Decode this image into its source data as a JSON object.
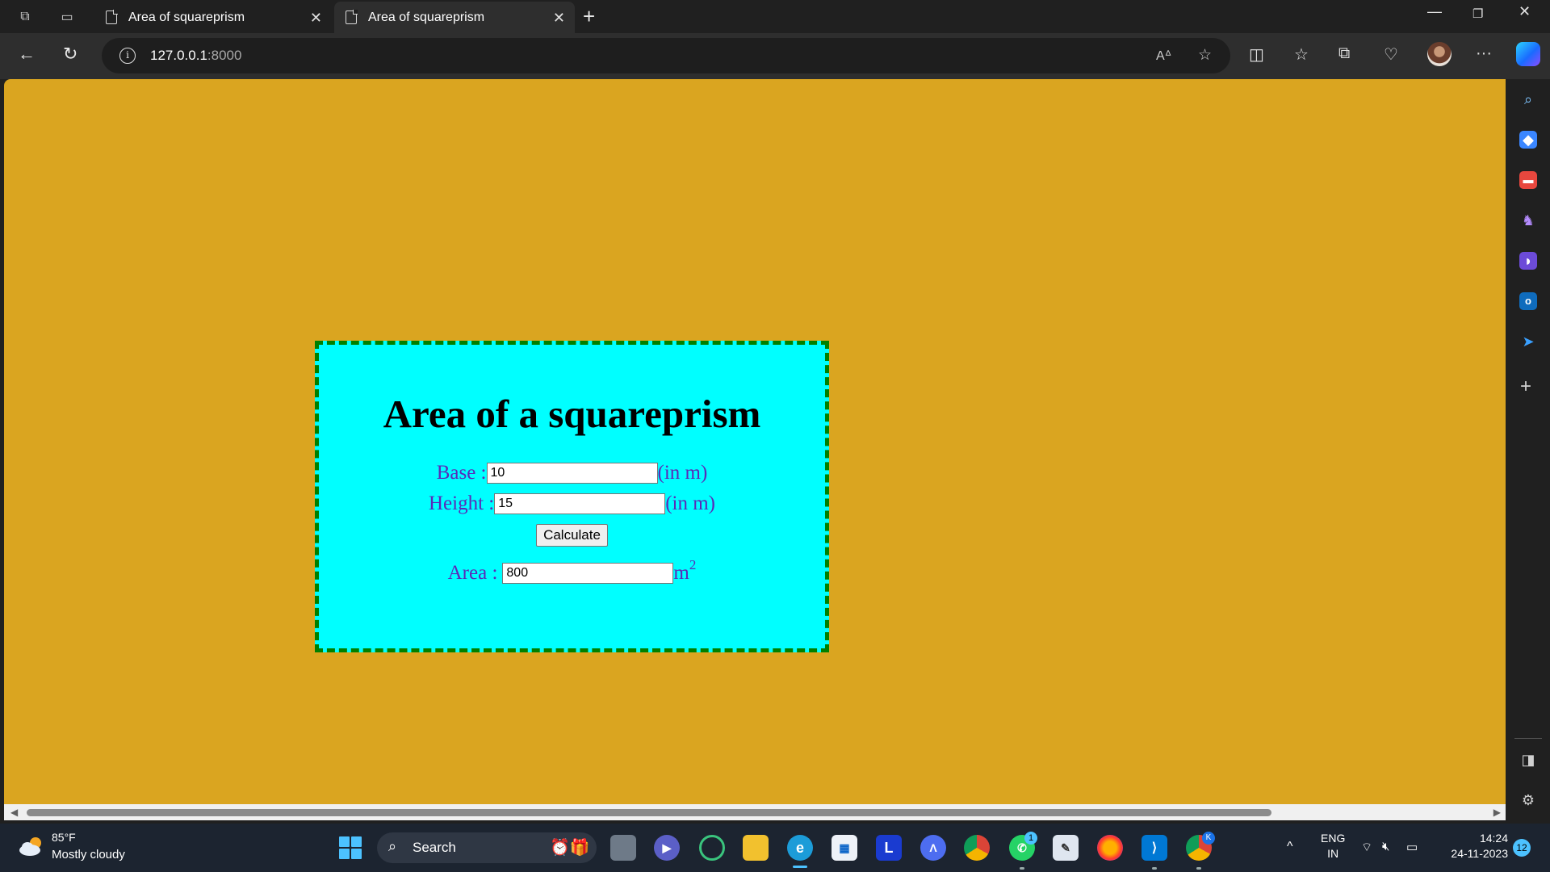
{
  "browser": {
    "tabs": [
      {
        "title": "Area of squareprism"
      },
      {
        "title": "Area of squareprism"
      }
    ],
    "address": {
      "host": "127.0.0.1",
      "port": ":8000"
    }
  },
  "page": {
    "heading": "Area of a squareprism",
    "base": {
      "label": "Base : ",
      "value": "10",
      "unit": "(in m)"
    },
    "height": {
      "label": "Height : ",
      "value": "15",
      "unit": "(in m)"
    },
    "calculate_label": "Calculate",
    "area": {
      "label": "Area : ",
      "value": "800",
      "unit": "m",
      "unit_power": "2"
    },
    "colors": {
      "background": "#daa520",
      "card": "#00ffff",
      "border": "#008000",
      "label_text": "#5a2ab8"
    }
  },
  "taskbar": {
    "weather": {
      "temp": "85°F",
      "desc": "Mostly cloudy"
    },
    "search_label": "Search",
    "language": {
      "line1": "ENG",
      "line2": "IN"
    },
    "clock": {
      "time": "14:24",
      "date": "24-11-2023"
    },
    "notifications": "12",
    "whatsapp_badge": "1",
    "chrome_badge": "K"
  }
}
